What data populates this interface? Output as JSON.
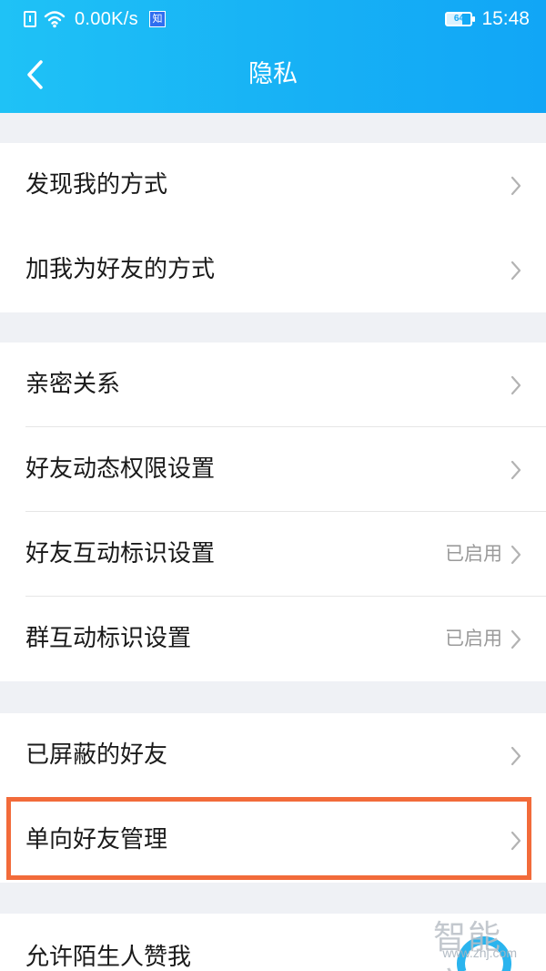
{
  "status_bar": {
    "speed": "0.00K/s",
    "app_badge": "知",
    "battery": "64",
    "battery_fraction": 0.64,
    "time": "15:48"
  },
  "nav": {
    "title": "隐私",
    "back_icon": "chevron-left-icon"
  },
  "groups": [
    {
      "items": [
        {
          "label": "发现我的方式",
          "status": ""
        },
        {
          "label": "加我为好友的方式",
          "status": ""
        }
      ]
    },
    {
      "items": [
        {
          "label": "亲密关系",
          "status": ""
        },
        {
          "label": "好友动态权限设置",
          "status": ""
        },
        {
          "label": "好友互动标识设置",
          "status": "已启用"
        },
        {
          "label": "群互动标识设置",
          "status": "已启用"
        }
      ]
    },
    {
      "items": [
        {
          "label": "已屏蔽的好友",
          "status": ""
        },
        {
          "label": "单向好友管理",
          "status": ""
        }
      ]
    },
    {
      "items": [
        {
          "label": "允许陌生人赞我",
          "status": ""
        }
      ]
    }
  ],
  "watermark": {
    "title": "智能家",
    "url": "www.znj.com"
  },
  "colors": {
    "header_start": "#1fc2f6",
    "header_end": "#11a6f6",
    "highlight": "#f26b3a",
    "background": "#eff1f5"
  }
}
